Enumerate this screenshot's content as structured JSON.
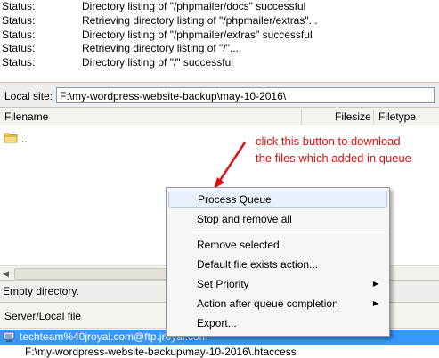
{
  "status_log": [
    {
      "label": "Status:",
      "message": "Directory listing of \"/phpmailer/docs\" successful"
    },
    {
      "label": "Status:",
      "message": "Retrieving directory listing of \"/phpmailer/extras\"..."
    },
    {
      "label": "Status:",
      "message": "Directory listing of \"/phpmailer/extras\" successful"
    },
    {
      "label": "Status:",
      "message": "Retrieving directory listing of \"/\"..."
    },
    {
      "label": "Status:",
      "message": "Directory listing of \"/\" successful"
    }
  ],
  "local_site": {
    "label": "Local site:",
    "path": "F:\\my-wordpress-website-backup\\may-10-2016\\"
  },
  "file_list": {
    "columns": [
      "Filename",
      "Filesize",
      "Filetype"
    ],
    "rows": [
      {
        "name": ".."
      }
    ]
  },
  "status_bar": {
    "text": "Empty directory."
  },
  "queue": {
    "column": "Server/Local file",
    "rows": [
      {
        "text": "techteam%40jroyal.com@ftp.jroyal.com"
      },
      {
        "text": "F:\\my-wordpress-website-backup\\may-10-2016\\.htaccess"
      }
    ]
  },
  "context_menu": {
    "items": [
      {
        "label": "Process Queue"
      },
      {
        "label": "Stop and remove all"
      },
      {
        "label": "Remove selected"
      },
      {
        "label": "Default file exists action..."
      },
      {
        "label": "Set Priority"
      },
      {
        "label": "Action after queue completion"
      },
      {
        "label": "Export..."
      }
    ]
  },
  "annotation": {
    "line1": "click this button to download",
    "line2": "the files which added in queue",
    "color": "#e01010"
  },
  "colors": {
    "selection": "#3399ff",
    "menu_highlight": "#e8f0fb"
  }
}
